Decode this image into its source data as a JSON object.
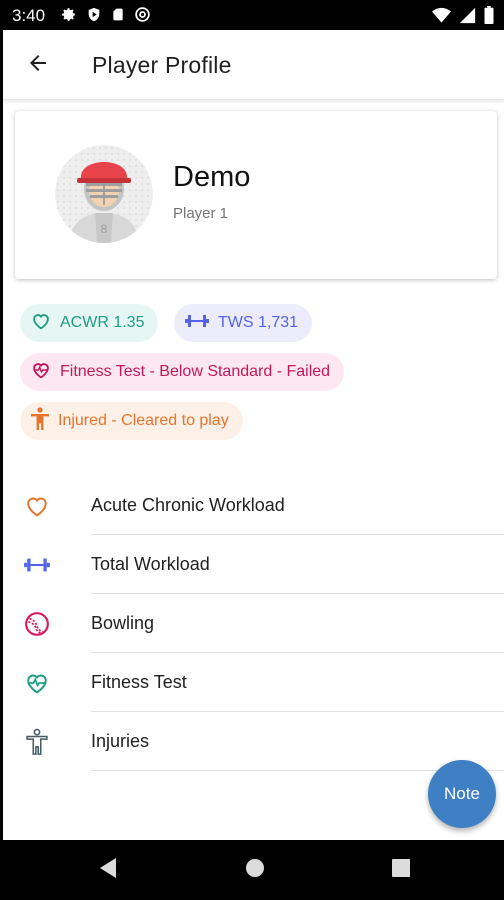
{
  "status_bar": {
    "time": "3:40"
  },
  "app_bar": {
    "title": "Player Profile"
  },
  "profile": {
    "name": "Demo",
    "subtitle": "Player 1"
  },
  "chips": {
    "acwr": {
      "label": "ACWR 1.35",
      "color": "#1f9d84"
    },
    "tws": {
      "label": "TWS 1,731",
      "color": "#5563e6"
    },
    "fitness": {
      "label": "Fitness Test - Below Standard - Failed",
      "color": "#c2185b"
    },
    "injury": {
      "label": "Injured - Cleared to play",
      "color": "#e6732e"
    }
  },
  "menu": {
    "items": [
      {
        "label": "Acute Chronic Workload",
        "icon": "heart-outline-icon"
      },
      {
        "label": "Total Workload",
        "icon": "dumbbell-icon"
      },
      {
        "label": "Bowling",
        "icon": "ball-icon"
      },
      {
        "label": "Fitness Test",
        "icon": "heart-pulse-icon"
      },
      {
        "label": "Injuries",
        "icon": "person-icon"
      }
    ]
  },
  "fab": {
    "label": "Note",
    "color": "#3f7fc4"
  }
}
